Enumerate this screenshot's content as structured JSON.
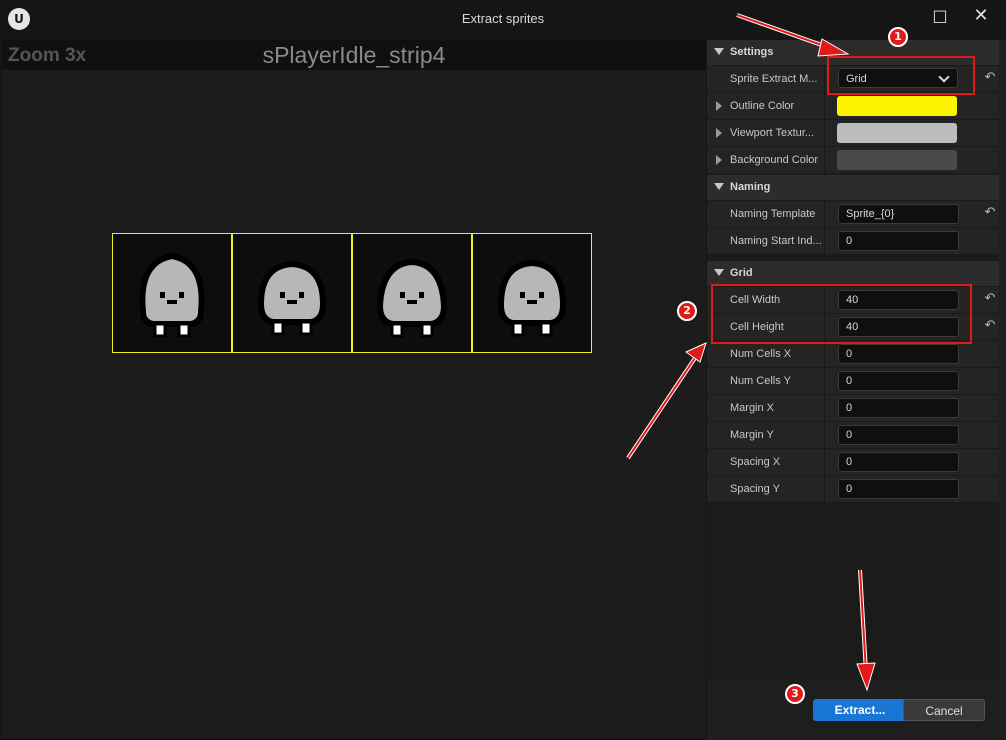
{
  "window": {
    "title": "Extract sprites",
    "logo_text": "U",
    "maximize_icon": "□",
    "close_icon": "✕"
  },
  "viewport": {
    "zoom": "Zoom 3x",
    "sprite_name": "sPlayerIdle_strip4",
    "frame_count": 4,
    "outline_color": "#f2ec1e"
  },
  "settings": {
    "header": "Settings",
    "rows": [
      {
        "label": "Sprite Extract M...",
        "value": "Grid"
      },
      {
        "label": "Outline Color",
        "color": "#fdf500"
      },
      {
        "label": "Viewport Textur...",
        "color": "#bdbdbd"
      },
      {
        "label": "Background Color",
        "color": "#4a4a4a"
      }
    ]
  },
  "naming": {
    "header": "Naming",
    "rows": [
      {
        "label": "Naming Template",
        "value": "Sprite_{0}"
      },
      {
        "label": "Naming Start Ind...",
        "value": "0"
      }
    ]
  },
  "grid": {
    "header": "Grid",
    "rows": [
      {
        "label": "Cell Width",
        "value": "40"
      },
      {
        "label": "Cell Height",
        "value": "40"
      },
      {
        "label": "Num Cells X",
        "value": "0"
      },
      {
        "label": "Num Cells Y",
        "value": "0"
      },
      {
        "label": "Margin X",
        "value": "0"
      },
      {
        "label": "Margin Y",
        "value": "0"
      },
      {
        "label": "Spacing X",
        "value": "0"
      },
      {
        "label": "Spacing Y",
        "value": "0"
      }
    ]
  },
  "buttons": {
    "extract": "Extract...",
    "cancel": "Cancel"
  },
  "icons": {
    "reset": "↶",
    "dropdown": "chevron-down-icon",
    "expander": "triangle-right-icon"
  },
  "annotations": {
    "badges": [
      "1",
      "2",
      "3"
    ],
    "color": "#e01919"
  }
}
